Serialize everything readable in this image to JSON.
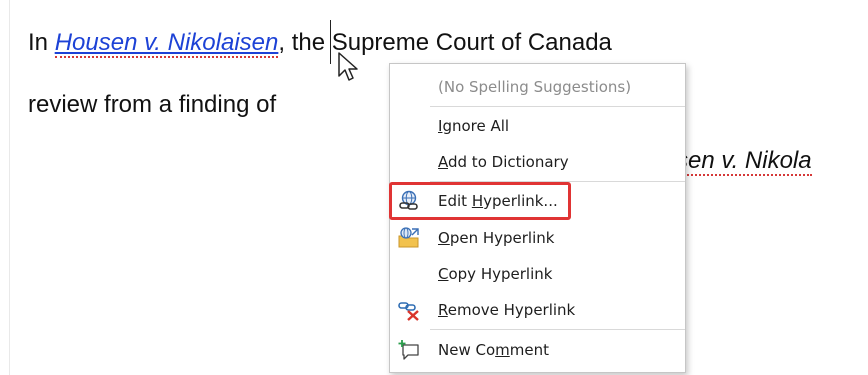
{
  "document": {
    "line1_prefix": "In ",
    "link_text": "Housen v. Nikolaisen",
    "line1_suffix": ", the Supreme Court of Canada",
    "line2": "review from a finding of",
    "line3": "sen v. Nikola"
  },
  "context_menu": {
    "items": [
      {
        "label": "(No Spelling Suggestions)",
        "enabled": false
      },
      {
        "label_pre": "",
        "label_acc": "I",
        "label_post": "gnore All"
      },
      {
        "label_pre": "",
        "label_acc": "A",
        "label_post": "dd to Dictionary"
      },
      {
        "label_pre": "Edit ",
        "label_acc": "H",
        "label_post": "yperlink...",
        "icon": "edit-hyperlink-icon",
        "highlighted": true
      },
      {
        "label_pre": "",
        "label_acc": "O",
        "label_post": "pen Hyperlink",
        "icon": "open-hyperlink-icon"
      },
      {
        "label_pre": "",
        "label_acc": "C",
        "label_post": "opy Hyperlink"
      },
      {
        "label_pre": "",
        "label_acc": "R",
        "label_post": "emove Hyperlink",
        "icon": "remove-hyperlink-icon"
      },
      {
        "label_pre": "New Co",
        "label_acc": "m",
        "label_post": "ment",
        "icon": "new-comment-icon"
      }
    ]
  },
  "colors": {
    "hyperlink": "#1d42d6",
    "spell_squiggle": "#d63838",
    "highlight_box": "#e03434"
  }
}
